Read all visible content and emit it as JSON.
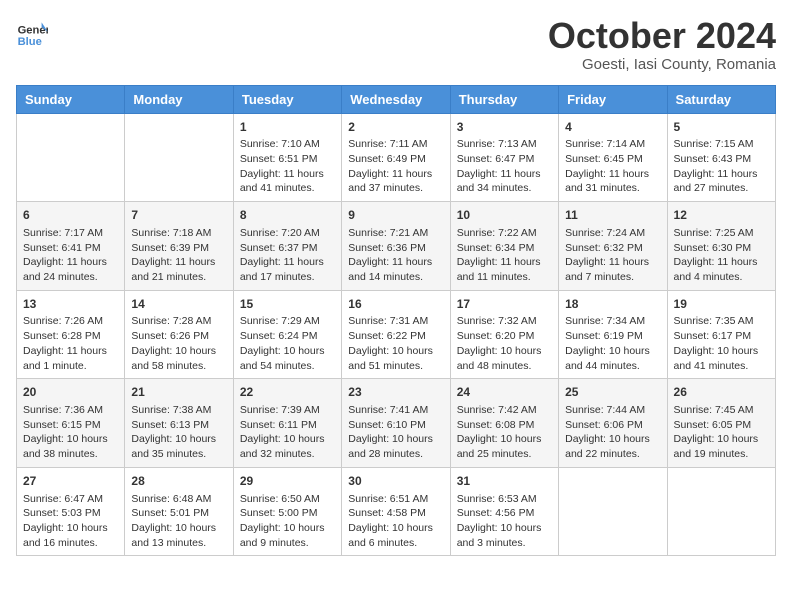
{
  "header": {
    "logo_general": "General",
    "logo_blue": "Blue",
    "month": "October 2024",
    "location": "Goesti, Iasi County, Romania"
  },
  "days_of_week": [
    "Sunday",
    "Monday",
    "Tuesday",
    "Wednesday",
    "Thursday",
    "Friday",
    "Saturday"
  ],
  "weeks": [
    [
      {
        "day": "",
        "sunrise": "",
        "sunset": "",
        "daylight": ""
      },
      {
        "day": "",
        "sunrise": "",
        "sunset": "",
        "daylight": ""
      },
      {
        "day": "1",
        "sunrise": "Sunrise: 7:10 AM",
        "sunset": "Sunset: 6:51 PM",
        "daylight": "Daylight: 11 hours and 41 minutes."
      },
      {
        "day": "2",
        "sunrise": "Sunrise: 7:11 AM",
        "sunset": "Sunset: 6:49 PM",
        "daylight": "Daylight: 11 hours and 37 minutes."
      },
      {
        "day": "3",
        "sunrise": "Sunrise: 7:13 AM",
        "sunset": "Sunset: 6:47 PM",
        "daylight": "Daylight: 11 hours and 34 minutes."
      },
      {
        "day": "4",
        "sunrise": "Sunrise: 7:14 AM",
        "sunset": "Sunset: 6:45 PM",
        "daylight": "Daylight: 11 hours and 31 minutes."
      },
      {
        "day": "5",
        "sunrise": "Sunrise: 7:15 AM",
        "sunset": "Sunset: 6:43 PM",
        "daylight": "Daylight: 11 hours and 27 minutes."
      }
    ],
    [
      {
        "day": "6",
        "sunrise": "Sunrise: 7:17 AM",
        "sunset": "Sunset: 6:41 PM",
        "daylight": "Daylight: 11 hours and 24 minutes."
      },
      {
        "day": "7",
        "sunrise": "Sunrise: 7:18 AM",
        "sunset": "Sunset: 6:39 PM",
        "daylight": "Daylight: 11 hours and 21 minutes."
      },
      {
        "day": "8",
        "sunrise": "Sunrise: 7:20 AM",
        "sunset": "Sunset: 6:37 PM",
        "daylight": "Daylight: 11 hours and 17 minutes."
      },
      {
        "day": "9",
        "sunrise": "Sunrise: 7:21 AM",
        "sunset": "Sunset: 6:36 PM",
        "daylight": "Daylight: 11 hours and 14 minutes."
      },
      {
        "day": "10",
        "sunrise": "Sunrise: 7:22 AM",
        "sunset": "Sunset: 6:34 PM",
        "daylight": "Daylight: 11 hours and 11 minutes."
      },
      {
        "day": "11",
        "sunrise": "Sunrise: 7:24 AM",
        "sunset": "Sunset: 6:32 PM",
        "daylight": "Daylight: 11 hours and 7 minutes."
      },
      {
        "day": "12",
        "sunrise": "Sunrise: 7:25 AM",
        "sunset": "Sunset: 6:30 PM",
        "daylight": "Daylight: 11 hours and 4 minutes."
      }
    ],
    [
      {
        "day": "13",
        "sunrise": "Sunrise: 7:26 AM",
        "sunset": "Sunset: 6:28 PM",
        "daylight": "Daylight: 11 hours and 1 minute."
      },
      {
        "day": "14",
        "sunrise": "Sunrise: 7:28 AM",
        "sunset": "Sunset: 6:26 PM",
        "daylight": "Daylight: 10 hours and 58 minutes."
      },
      {
        "day": "15",
        "sunrise": "Sunrise: 7:29 AM",
        "sunset": "Sunset: 6:24 PM",
        "daylight": "Daylight: 10 hours and 54 minutes."
      },
      {
        "day": "16",
        "sunrise": "Sunrise: 7:31 AM",
        "sunset": "Sunset: 6:22 PM",
        "daylight": "Daylight: 10 hours and 51 minutes."
      },
      {
        "day": "17",
        "sunrise": "Sunrise: 7:32 AM",
        "sunset": "Sunset: 6:20 PM",
        "daylight": "Daylight: 10 hours and 48 minutes."
      },
      {
        "day": "18",
        "sunrise": "Sunrise: 7:34 AM",
        "sunset": "Sunset: 6:19 PM",
        "daylight": "Daylight: 10 hours and 44 minutes."
      },
      {
        "day": "19",
        "sunrise": "Sunrise: 7:35 AM",
        "sunset": "Sunset: 6:17 PM",
        "daylight": "Daylight: 10 hours and 41 minutes."
      }
    ],
    [
      {
        "day": "20",
        "sunrise": "Sunrise: 7:36 AM",
        "sunset": "Sunset: 6:15 PM",
        "daylight": "Daylight: 10 hours and 38 minutes."
      },
      {
        "day": "21",
        "sunrise": "Sunrise: 7:38 AM",
        "sunset": "Sunset: 6:13 PM",
        "daylight": "Daylight: 10 hours and 35 minutes."
      },
      {
        "day": "22",
        "sunrise": "Sunrise: 7:39 AM",
        "sunset": "Sunset: 6:11 PM",
        "daylight": "Daylight: 10 hours and 32 minutes."
      },
      {
        "day": "23",
        "sunrise": "Sunrise: 7:41 AM",
        "sunset": "Sunset: 6:10 PM",
        "daylight": "Daylight: 10 hours and 28 minutes."
      },
      {
        "day": "24",
        "sunrise": "Sunrise: 7:42 AM",
        "sunset": "Sunset: 6:08 PM",
        "daylight": "Daylight: 10 hours and 25 minutes."
      },
      {
        "day": "25",
        "sunrise": "Sunrise: 7:44 AM",
        "sunset": "Sunset: 6:06 PM",
        "daylight": "Daylight: 10 hours and 22 minutes."
      },
      {
        "day": "26",
        "sunrise": "Sunrise: 7:45 AM",
        "sunset": "Sunset: 6:05 PM",
        "daylight": "Daylight: 10 hours and 19 minutes."
      }
    ],
    [
      {
        "day": "27",
        "sunrise": "Sunrise: 6:47 AM",
        "sunset": "Sunset: 5:03 PM",
        "daylight": "Daylight: 10 hours and 16 minutes."
      },
      {
        "day": "28",
        "sunrise": "Sunrise: 6:48 AM",
        "sunset": "Sunset: 5:01 PM",
        "daylight": "Daylight: 10 hours and 13 minutes."
      },
      {
        "day": "29",
        "sunrise": "Sunrise: 6:50 AM",
        "sunset": "Sunset: 5:00 PM",
        "daylight": "Daylight: 10 hours and 9 minutes."
      },
      {
        "day": "30",
        "sunrise": "Sunrise: 6:51 AM",
        "sunset": "Sunset: 4:58 PM",
        "daylight": "Daylight: 10 hours and 6 minutes."
      },
      {
        "day": "31",
        "sunrise": "Sunrise: 6:53 AM",
        "sunset": "Sunset: 4:56 PM",
        "daylight": "Daylight: 10 hours and 3 minutes."
      },
      {
        "day": "",
        "sunrise": "",
        "sunset": "",
        "daylight": ""
      },
      {
        "day": "",
        "sunrise": "",
        "sunset": "",
        "daylight": ""
      }
    ]
  ]
}
